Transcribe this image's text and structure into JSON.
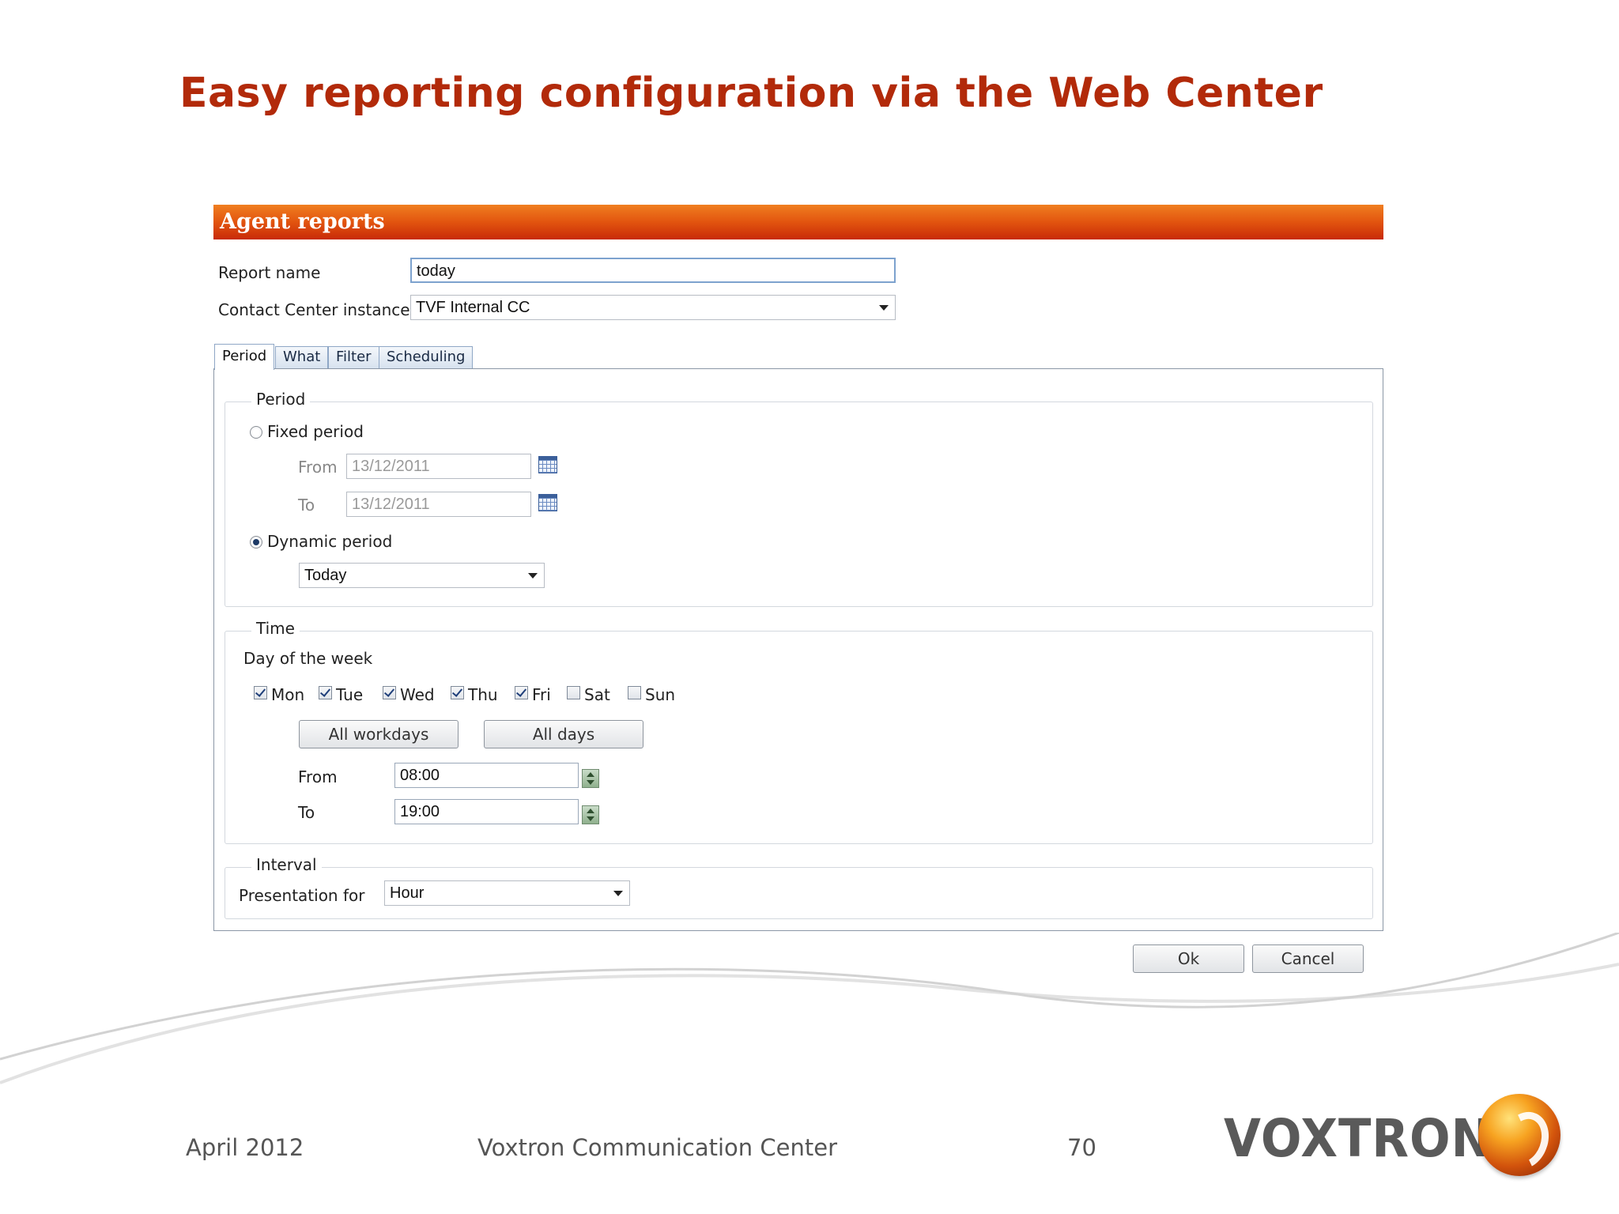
{
  "slide": {
    "title": "Easy reporting configuration via the Web Center"
  },
  "dialog": {
    "title": "Agent reports",
    "report_name_label": "Report name",
    "report_name_value": "today",
    "instance_label": "Contact Center instance",
    "instance_value": "TVF Internal CC",
    "tabs": [
      {
        "label": "Period",
        "active": true
      },
      {
        "label": "What",
        "active": false
      },
      {
        "label": "Filter",
        "active": false
      },
      {
        "label": "Scheduling",
        "active": false
      }
    ],
    "period": {
      "legend": "Period",
      "fixed_label": "Fixed period",
      "fixed_selected": false,
      "from_label": "From",
      "from_value": "13/12/2011",
      "to_label": "To",
      "to_value": "13/12/2011",
      "dynamic_label": "Dynamic period",
      "dynamic_selected": true,
      "dynamic_value": "Today"
    },
    "time": {
      "legend": "Time",
      "day_of_week_label": "Day of the week",
      "days": [
        {
          "label": "Mon",
          "checked": true
        },
        {
          "label": "Tue",
          "checked": true
        },
        {
          "label": "Wed",
          "checked": true
        },
        {
          "label": "Thu",
          "checked": true
        },
        {
          "label": "Fri",
          "checked": true
        },
        {
          "label": "Sat",
          "checked": false
        },
        {
          "label": "Sun",
          "checked": false
        }
      ],
      "all_workdays_label": "All workdays",
      "all_days_label": "All days",
      "from_label": "From",
      "from_value": "08:00",
      "to_label": "To",
      "to_value": "19:00"
    },
    "interval": {
      "legend": "Interval",
      "presentation_label": "Presentation for",
      "presentation_value": "Hour"
    },
    "ok_label": "Ok",
    "cancel_label": "Cancel"
  },
  "footer": {
    "date": "April 2012",
    "product": "Voxtron Communication Center",
    "page_number": "70"
  },
  "logo": {
    "text": "VOXTRON"
  },
  "colors": {
    "title": "#b22a0a",
    "header_top": "#f07f20",
    "header_bottom": "#c82a08"
  }
}
